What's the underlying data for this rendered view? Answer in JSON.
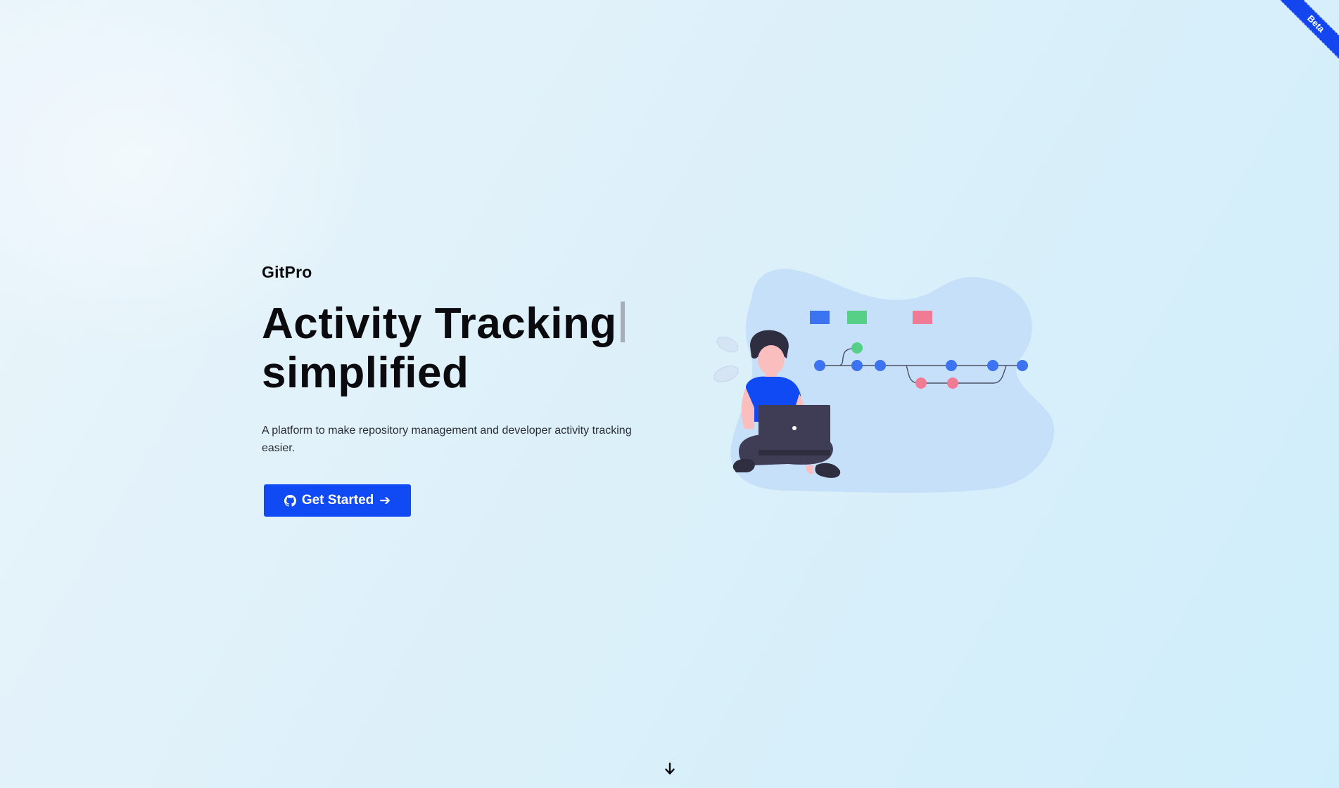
{
  "ribbon": {
    "label": "Beta"
  },
  "hero": {
    "brand": "GitPro",
    "headline_line1": "Activity Tracking",
    "headline_line2": "simplified",
    "description": "A platform to make repository management and developer activity tracking easier.",
    "cta_label": "Get Started",
    "cta_arrow": "➔"
  },
  "icons": {
    "cta_icon": "github-icon",
    "scroll": "arrow-down-icon"
  },
  "colors": {
    "accent": "#0f4af5",
    "ribbon": "#1446f0",
    "commit_blue": "#3b73f0",
    "commit_green": "#56cf87",
    "commit_pink": "#f07b94",
    "blob": "#c7e0fa",
    "laptop": "#3f3d56"
  }
}
